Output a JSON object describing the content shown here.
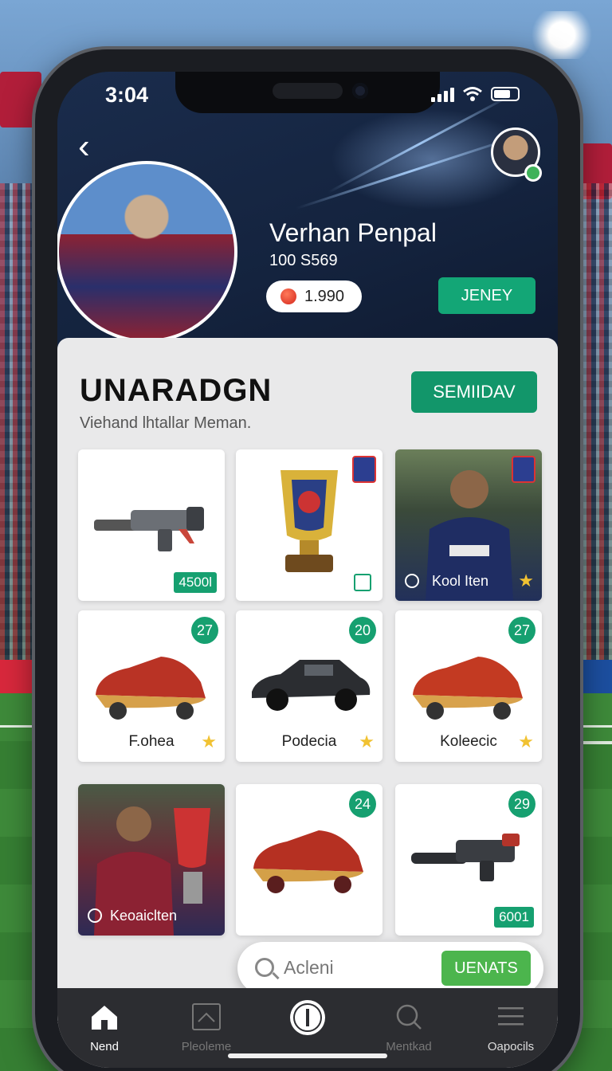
{
  "status": {
    "time": "3:04"
  },
  "profile": {
    "name": "Verhan Penpal",
    "sub": "100  S569",
    "coins": "1.990",
    "action_label": "JENEY"
  },
  "section": {
    "title": "UNARADGN",
    "subtitle": "Viehand lhtallar Meman.",
    "button_label": "SEMIIDAV"
  },
  "cards": [
    {
      "kind": "gun",
      "price": "4500l"
    },
    {
      "kind": "trophy"
    },
    {
      "kind": "player",
      "label": "Kool Iten"
    },
    {
      "kind": "shoe",
      "badge": "27",
      "label": "F.ohea"
    },
    {
      "kind": "car",
      "badge": "20",
      "label": "Podecia"
    },
    {
      "kind": "shoe",
      "badge": "27",
      "label": "Koleecic"
    },
    {
      "kind": "player-trophy",
      "label": "Keoaiclten"
    },
    {
      "kind": "shoe",
      "badge": "24"
    },
    {
      "kind": "gun",
      "badge": "29",
      "price": "6001"
    }
  ],
  "search": {
    "placeholder": "Acleni",
    "button_label": "UENATS"
  },
  "tabs": [
    {
      "label": "Nend",
      "icon": "home-icon"
    },
    {
      "label": "Pleoleme",
      "icon": "image-icon"
    },
    {
      "label": "",
      "icon": "center-action-icon"
    },
    {
      "label": "Mentkad",
      "icon": "search-icon"
    },
    {
      "label": "Oapocils",
      "icon": "menu-icon"
    }
  ],
  "colors": {
    "accent": "#13a676",
    "search_go": "#4cb54d",
    "header": "#14233e"
  }
}
